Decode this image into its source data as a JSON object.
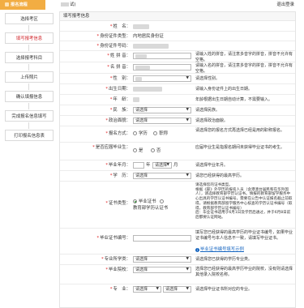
{
  "header": {
    "brand": "报名流程",
    "crumb_tail": "试)",
    "logout": "退出登录"
  },
  "sidebar": {
    "items": [
      {
        "label": "选择考区",
        "active": false
      },
      {
        "label": "填写报考信息",
        "active": true
      },
      {
        "label": "选择报考科目",
        "active": false
      },
      {
        "label": "上传照片",
        "active": false
      },
      {
        "label": "确认填报信息",
        "active": false
      },
      {
        "label": "完成报名信息填写",
        "active": false
      },
      {
        "label": "打印报名信息表",
        "active": false
      }
    ]
  },
  "form": {
    "title": "填写报考信息",
    "name": {
      "label": "姓　名：",
      "hint": ""
    },
    "id_type": {
      "label": "身份证件类型：",
      "value": "内地居民身份证"
    },
    "id_no": {
      "label": "身份证件号码："
    },
    "pinyin_first": {
      "label": "姓 拼 音：",
      "hint": "请输入姓的拼音，请注意多音字的拼音，拼音不允许有空格。"
    },
    "pinyin_last": {
      "label": "名 拼 音：",
      "hint": "请输入名的拼音，请注意多音字的拼音，拼音不允许有空格。"
    },
    "gender": {
      "label": "性　别：",
      "hint": "请选择性别。"
    },
    "birth": {
      "label": "出生日期：",
      "hint": "请输入身份证件上的出生日期。"
    },
    "age": {
      "label": "年　龄：",
      "hint": "年龄根据出生日期自动计算，不需要输入。"
    },
    "ethnic": {
      "label": "民　族：",
      "value": "请选择",
      "hint": "请选择民族。"
    },
    "political": {
      "label": "政治面貌：",
      "value": "请选择",
      "hint": "请选择政治面貌。"
    },
    "study_mode": {
      "label": "报名方式：",
      "opt1": "学历",
      "opt2": "职称",
      "hint": "请选择您的报名方式再选择已经是用的职称报名。"
    },
    "graduate": {
      "label": "是否应届毕业生：",
      "opt1": "是",
      "opt2": "否",
      "hint": "应届毕业生是指报名期间未获得毕业证书的考生。"
    },
    "grad_date": {
      "label": "毕业年月：",
      "year_unit": "年",
      "month_value": "请选择",
      "month_unit": "月",
      "hint": "请选择毕业年月。"
    },
    "education": {
      "label": "学　历：",
      "value": "请选择",
      "hint": "请您已经获得的最高学历。"
    },
    "cert_type": {
      "label": "证书类型：",
      "opt1": "毕业证书",
      "opt2": "教育部学历认证书",
      "hint": "请选择您的证书类型。\n根据《部》外学历的报名人员（含港澳台居民和在华外国人），请选择教育部学历认证书。填报的教育部留学服务中心出具的学历认证书编号，需要在公告中认证报名截止前取得。请根据教育部留学服务中心核查的学历认证书编号（取得，教育部学历认证书编号）\n后：毕业证书适用于6月1日及学历后通过，并于6月8日前后都要认证网站。"
    },
    "cert_no": {
      "label": "毕业证书编号：",
      "hint": "填写您已经获得的最高学历的毕业证书编号，如果毕业证书编号与本人信息不一致，请填写毕业证书。",
      "link": "毕业证书编号填写示例"
    },
    "major_cat": {
      "label": "专业所学类：",
      "value": "请选择",
      "hint": "请选择您已获得的学历专业类。"
    },
    "school": {
      "label": "毕业院校：",
      "value": "请选择",
      "hint": "选择您已经获得的最高学历毕业的院校，没有则请选择其他录入院校名称。"
    },
    "major": {
      "label": "专　业：",
      "value1": "请选择",
      "value2": "请选择",
      "hint": "请选择毕业证书所对应的专业。"
    }
  },
  "colors": {
    "brand": "#f2ad43",
    "active_text": "#d0242a",
    "required": "#e02020",
    "link": "#1565c0"
  }
}
